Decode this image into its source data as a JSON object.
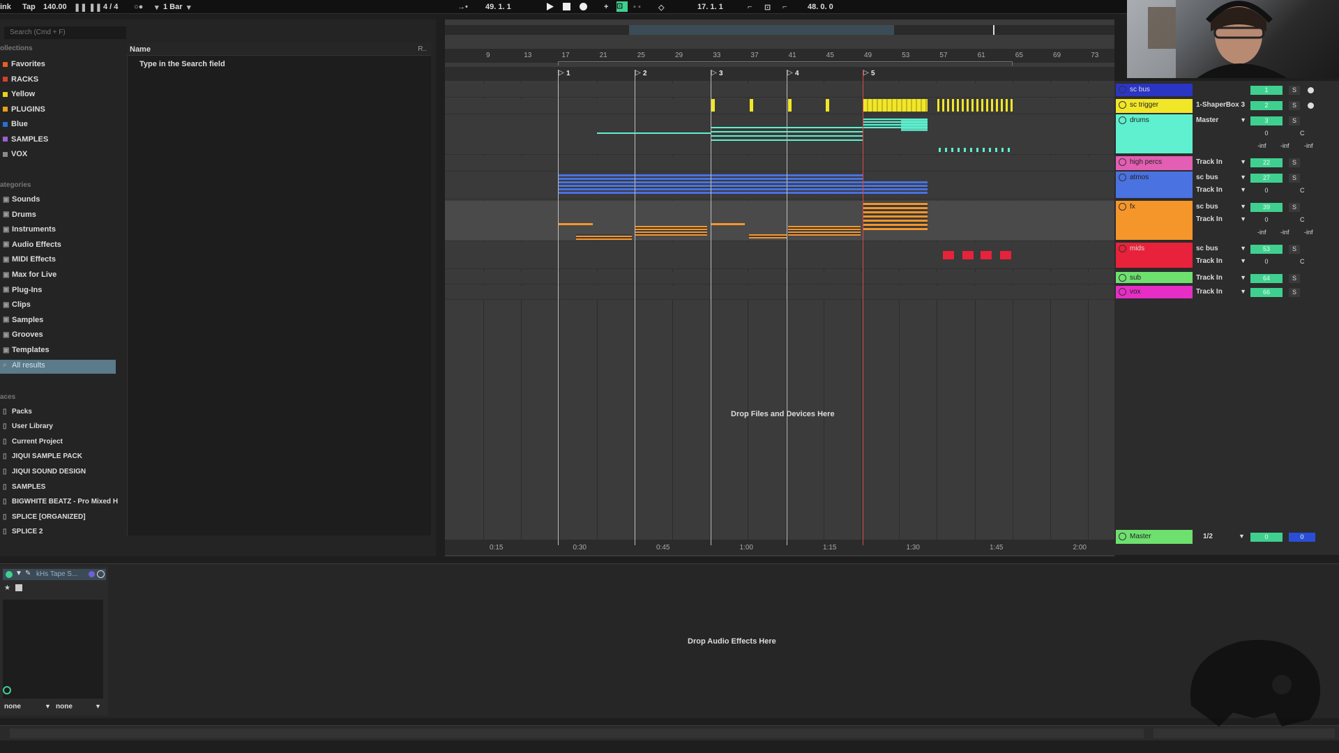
{
  "transport": {
    "link": "ink",
    "tap": "Tap",
    "tempo": "140.00",
    "signature": "4 / 4",
    "quantize": "1 Bar",
    "position": "49. 1. 1",
    "loop_start": "17. 1. 1",
    "loop_length": "48. 0. 0"
  },
  "browser": {
    "search_placeholder": "Search (Cmd + F)",
    "collections_label": "ollections",
    "collections": [
      {
        "label": "Favorites",
        "color": "#e85d24"
      },
      {
        "label": "RACKS",
        "color": "#d6402a"
      },
      {
        "label": "Yellow",
        "color": "#e8d41a"
      },
      {
        "label": "PLUGINS",
        "color": "#e8a11a"
      },
      {
        "label": "Blue",
        "color": "#2a6fd6"
      },
      {
        "label": "SAMPLES",
        "color": "#9b5fd6"
      },
      {
        "label": "VOX",
        "color": "#8a8a8a"
      }
    ],
    "categories_label": "ategories",
    "categories": [
      "Sounds",
      "Drums",
      "Instruments",
      "Audio Effects",
      "MIDI Effects",
      "Max for Live",
      "Plug-Ins",
      "Clips",
      "Samples",
      "Grooves",
      "Templates",
      "All results"
    ],
    "places_label": "aces",
    "places": [
      "Packs",
      "User Library",
      "Current Project",
      "JIQUI SAMPLE PACK",
      "JIQUI SOUND DESIGN",
      "SAMPLES",
      "BIGWHITE BEATZ - Pro Mixed H",
      "SPLICE [ORGANIZED]",
      "SPLICE 2"
    ],
    "name_header": "Name",
    "name_header_right": "R..",
    "hint": "Type in the Search field"
  },
  "arrangement": {
    "bar_ticks": [
      "9",
      "13",
      "17",
      "21",
      "25",
      "29",
      "33",
      "37",
      "41",
      "45",
      "49",
      "53",
      "57",
      "61",
      "65",
      "69",
      "73"
    ],
    "locators": [
      "1",
      "2",
      "3",
      "4",
      "5"
    ],
    "time_ticks": [
      "0:15",
      "0:30",
      "0:45",
      "1:00",
      "1:15",
      "1:30",
      "1:45",
      "2:00"
    ],
    "drop_hint": "Drop Files and Devices Here"
  },
  "mixer": {
    "tracks": [
      {
        "name": "sc bus",
        "color": "#2b35c4",
        "route": "",
        "vol": "1"
      },
      {
        "name": "sc trigger",
        "color": "#f2e629",
        "route": "1-ShaperBox 3",
        "vol": "2"
      },
      {
        "name": "drums",
        "color": "#5ef0cf",
        "route": "Master",
        "vol": "3"
      },
      {
        "name": "high percs",
        "color": "#e35fb3",
        "route": "Track In",
        "vol": "22"
      },
      {
        "name": "atmos",
        "color": "#4a72e0",
        "route": "sc bus",
        "vol": "27"
      },
      {
        "name": "fx",
        "color": "#f5962a",
        "route": "sc bus",
        "vol": "39"
      },
      {
        "name": "mids",
        "color": "#e8223a",
        "route": "sc bus",
        "vol": "53"
      },
      {
        "name": "sub",
        "color": "#6ee06e",
        "route": "Track In",
        "vol": "64"
      },
      {
        "name": "vox",
        "color": "#e62ec6",
        "route": "Track In",
        "vol": "66"
      }
    ],
    "track_in": "Track In",
    "zero": "0",
    "c": "C",
    "inf": "-inf",
    "solo": "S",
    "master": {
      "name": "Master",
      "route": "1/2",
      "vol": "0",
      "vol2": "0",
      "color": "#6ee06e"
    }
  },
  "device": {
    "device_name": "kHs Tape S...",
    "none1": "none",
    "none2": "none",
    "drop_hint": "Drop Audio Effects Here"
  }
}
